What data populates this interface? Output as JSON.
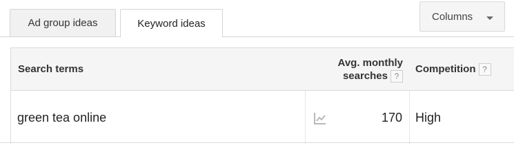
{
  "tabs": [
    {
      "label": "Ad group ideas",
      "active": false
    },
    {
      "label": "Keyword ideas",
      "active": true
    }
  ],
  "columns_button": {
    "label": "Columns",
    "icon": "caret-down-icon"
  },
  "table": {
    "headers": {
      "search_terms": "Search terms",
      "avg_monthly_line1": "Avg. monthly",
      "avg_monthly_line2": "searches",
      "competition": "Competition",
      "help": "?"
    },
    "rows": [
      {
        "term": "green tea online",
        "trend_icon": "trend-chart-icon",
        "avg_monthly_searches": "170",
        "competition": "High"
      }
    ]
  },
  "colors": {
    "header_bg": "#f5f5f5",
    "tab_inactive_bg": "#f1f1f1",
    "border": "#dadada",
    "icon_gray": "#b8b8b8"
  }
}
